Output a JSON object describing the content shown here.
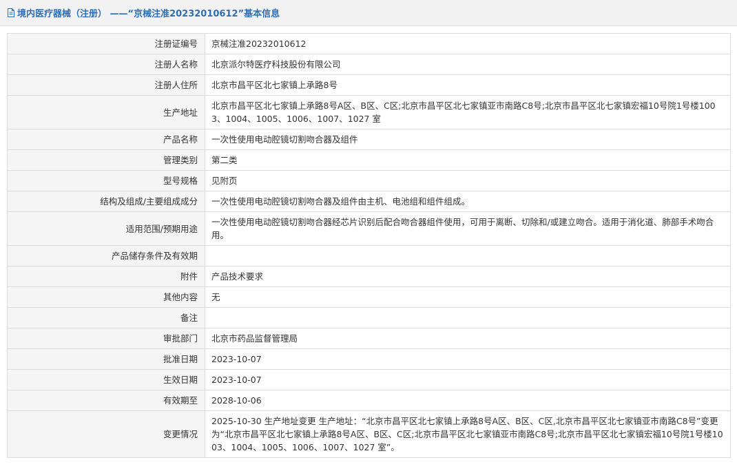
{
  "header": {
    "title": "境内医疗器械（注册） ——“京械注准20232010612”基本信息"
  },
  "rows": [
    {
      "label": "注册证编号",
      "value": "京械注准20232010612"
    },
    {
      "label": "注册人名称",
      "value": "北京派尔特医疗科技股份有限公司"
    },
    {
      "label": "注册人住所",
      "value": "北京市昌平区北七家镇上承路8号"
    },
    {
      "label": "生产地址",
      "value": "北京市昌平区北七家镇上承路8号A区、B区、C区;北京市昌平区北七家镇亚市南路C8号;北京市昌平区北七家镇宏福10号院1号楼1003、1004、1005、1006、1007、1027 室"
    },
    {
      "label": "产品名称",
      "value": "一次性使用电动腔镜切割吻合器及组件"
    },
    {
      "label": "管理类别",
      "value": "第二类"
    },
    {
      "label": "型号规格",
      "value": "见附页"
    },
    {
      "label": "结构及组成/主要组成成分",
      "value": "一次性使用电动腔镜切割吻合器及组件由主机、电池组和组件组成。"
    },
    {
      "label": "适用范围/预期用途",
      "value": "一次性使用电动腔镜切割吻合器经芯片识别后配合吻合器组件使用，可用于离断、切除和/或建立吻合。适用于消化道、肺部手术吻合用。"
    },
    {
      "label": "产品储存条件及有效期",
      "value": ""
    },
    {
      "label": "附件",
      "value": "产品技术要求"
    },
    {
      "label": "其他内容",
      "value": "无"
    },
    {
      "label": "备注",
      "value": ""
    },
    {
      "label": "审批部门",
      "value": "北京市药品监督管理局"
    },
    {
      "label": "批准日期",
      "value": "2023-10-07"
    },
    {
      "label": "生效日期",
      "value": "2023-10-07"
    },
    {
      "label": "有效期至",
      "value": "2028-10-06"
    },
    {
      "label": "变更情况",
      "value": "2025-10-30 生产地址变更 生产地址：“北京市昌平区北七家镇上承路8号A区、B区、C区,北京市昌平区北七家镇亚市南路C8号”变更为“北京市昌平区北七家镇上承路8号A区、B区、C区;北京市昌平区北七家镇亚市南路C8号;北京市昌平区北七家镇宏福10号院1号楼1003、1004、1005、1006、1007、1027 室”。"
    }
  ],
  "icons": {
    "header_icon": "document-icon"
  },
  "colors": {
    "header_text": "#2d6fb7",
    "header_bg": "#f2f2f2",
    "label_bg": "#f5f5f5",
    "border": "#dcdcdc"
  }
}
